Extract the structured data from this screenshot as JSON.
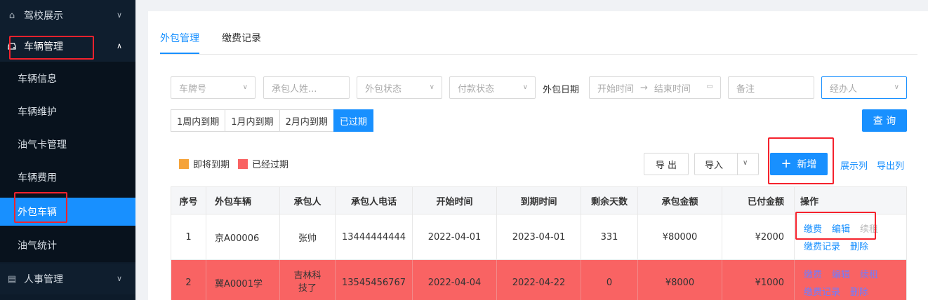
{
  "sidebar": {
    "groups": [
      {
        "label": "驾校展示",
        "icon": "home-icon",
        "expanded": false
      },
      {
        "label": "车辆管理",
        "icon": "car-icon",
        "expanded": true
      },
      {
        "label": "人事管理",
        "icon": "document-icon",
        "expanded": false
      }
    ],
    "items": [
      {
        "label": "车辆信息"
      },
      {
        "label": "车辆维护"
      },
      {
        "label": "油气卡管理"
      },
      {
        "label": "车辆费用"
      },
      {
        "label": "外包车辆",
        "active": true
      },
      {
        "label": "油气统计"
      }
    ]
  },
  "tabs": [
    {
      "label": "外包管理",
      "active": true
    },
    {
      "label": "缴费记录",
      "active": false
    }
  ],
  "filters": {
    "plate_placeholder": "车牌号",
    "contractor_placeholder": "承包人姓...",
    "outsource_status_placeholder": "外包状态",
    "payment_status_placeholder": "付款状态",
    "date_label": "外包日期",
    "start_placeholder": "开始时间",
    "date_arrow": "→",
    "end_placeholder": "结束时间",
    "remark_placeholder": "备注",
    "handler_placeholder": "经办人"
  },
  "quick_ranges": [
    {
      "label": "1周内到期",
      "active": false
    },
    {
      "label": "1月内到期",
      "active": false
    },
    {
      "label": "2月内到期",
      "active": false
    },
    {
      "label": "已过期",
      "active": true
    }
  ],
  "actions": {
    "query": "查 询",
    "export": "导 出",
    "import": "导入",
    "add": "新增",
    "show_columns": "展示列",
    "export_columns": "导出列"
  },
  "legend": [
    {
      "label": "即将到期",
      "color": "#f5a33a"
    },
    {
      "label": "已经过期",
      "color": "#f96363"
    }
  ],
  "table": {
    "headers": [
      "序号",
      "外包车辆",
      "承包人",
      "承包人电话",
      "开始时间",
      "到期时间",
      "剩余天数",
      "承包金额",
      "已付金额",
      "操作"
    ],
    "rows": [
      {
        "no": "1",
        "vehicle": "京A00006",
        "contractor": "张帅",
        "phone": "13444444444",
        "start": "2022-04-01",
        "end": "2023-04-01",
        "days": "331",
        "amount": "¥80000",
        "paid": "¥2000",
        "status": "normal"
      },
      {
        "no": "2",
        "vehicle": "冀A0001学",
        "contractor": "吉林科技了",
        "phone": "13545456767",
        "start": "2022-04-04",
        "end": "2022-04-22",
        "days": "0",
        "amount": "¥8000",
        "paid": "¥1000",
        "status": "expired"
      }
    ],
    "ops": {
      "pay": "缴费",
      "edit": "编辑",
      "renew": "续租",
      "records": "缴费记录",
      "delete": "删除"
    }
  }
}
